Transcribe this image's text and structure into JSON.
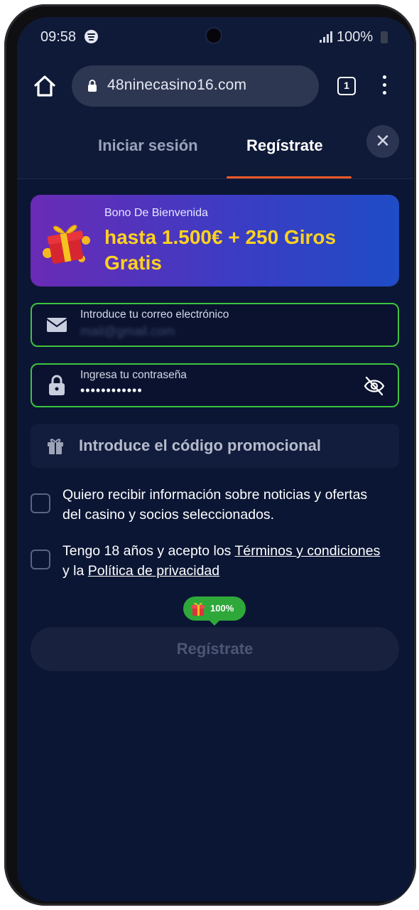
{
  "status": {
    "time": "09:58",
    "battery": "100%"
  },
  "browser": {
    "url": "48ninecasino16.com",
    "tab_count": "1"
  },
  "auth_tabs": {
    "login": "Iniciar sesión",
    "register": "Regístrate",
    "active": "register"
  },
  "bonus": {
    "label": "Bono De Bienvenida",
    "title": "hasta 1.500€ + 250 Giros Gratis"
  },
  "form": {
    "email_label": "Introduce tu correo electrónico",
    "email_value": "mail@gmail.com",
    "password_label": "Ingresa tu contraseña",
    "password_value": "••••••••••••",
    "promo_placeholder": "Introduce el código promocional"
  },
  "consents": {
    "news_text": "Quiero recibir información sobre noticias y ofertas del casino y socios seleccionados.",
    "terms_prefix": "Tengo 18 años y acepto los ",
    "terms_link": "Términos y condiciones",
    "terms_middle": " y la ",
    "privacy_link": "Política de privacidad",
    "news_checked": false,
    "terms_checked": false
  },
  "badge": {
    "percent": "100%"
  },
  "submit_label": "Regístrate",
  "colors": {
    "accent_underline": "#f05a28",
    "valid_border": "#3dc43d",
    "bonus_title": "#ffd21f",
    "background": "#0b1634"
  }
}
